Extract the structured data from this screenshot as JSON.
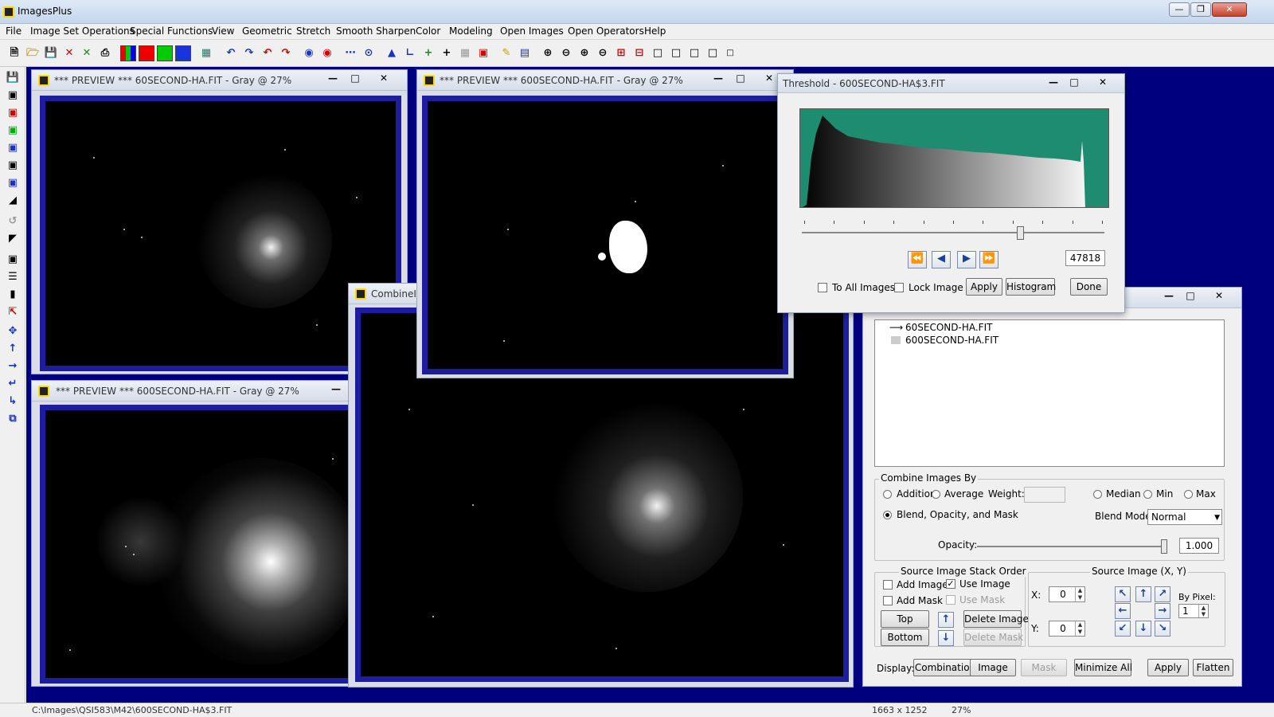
{
  "app": {
    "title": "ImagesPlus"
  },
  "menu": [
    "File",
    "Image Set Operations",
    "Special Functions",
    "View",
    "Geometric",
    "Stretch",
    "Smooth Sharpen",
    "Color",
    "Modeling",
    "Open Images",
    "Open Operators",
    "Help"
  ],
  "preview_windows": {
    "win1": {
      "title": "*** PREVIEW *** 60SECOND-HA.FIT - Gray @ 27%"
    },
    "win2": {
      "title": "*** PREVIEW *** 600SECOND-HA.FIT - Gray @ 27%"
    },
    "win3": {
      "title": "*** PREVIEW *** 600SECOND-HA.FIT - Gray @ 27%"
    },
    "win4": {
      "title": "CombineIn"
    }
  },
  "threshold": {
    "title": "Threshold - 600SECOND-HA$3.FIT",
    "value": "47818",
    "slider_fraction": 0.72,
    "to_all_images": "To All Images",
    "lock_image": "Lock Image",
    "apply": "Apply",
    "histogram": "Histogram",
    "done": "Done",
    "accent_color": "#1e8c6e"
  },
  "combine": {
    "layers": [
      "60SECOND-HA.FIT",
      "600SECOND-HA.FIT"
    ],
    "combine_by_label": "Combine Images By",
    "addition": "Addition",
    "average": "Average",
    "weight_label": "Weight:",
    "median": "Median",
    "min": "Min",
    "max": "Max",
    "blend_label": "Blend, Opacity, and Mask",
    "blend_mode_label": "Blend Mode:",
    "blend_mode_value": "Normal",
    "opacity_label": "Opacity:",
    "opacity_value": "1.000",
    "stack_order_label": "Source Image Stack Order",
    "add_image": "Add Image",
    "use_image": "Use Image",
    "add_mask": "Add Mask",
    "use_mask": "Use Mask",
    "top": "Top",
    "bottom": "Bottom",
    "delete_image": "Delete Image",
    "delete_mask": "Delete Mask",
    "source_xy_label": "Source Image (X, Y)",
    "x_label": "X:",
    "x_value": "0",
    "y_label": "Y:",
    "y_value": "0",
    "by_pixel_label": "By Pixel:",
    "by_pixel_value": "1",
    "display_label": "Display:",
    "combination": "Combination",
    "image": "Image",
    "mask": "Mask",
    "minimize_all": "Minimize All",
    "apply": "Apply",
    "flatten": "Flatten"
  },
  "status": {
    "path": "C:\\Images\\QSI583\\M42\\600SECOND-HA$3.FIT",
    "size": "1663 x 1252",
    "zoom": "27%"
  }
}
